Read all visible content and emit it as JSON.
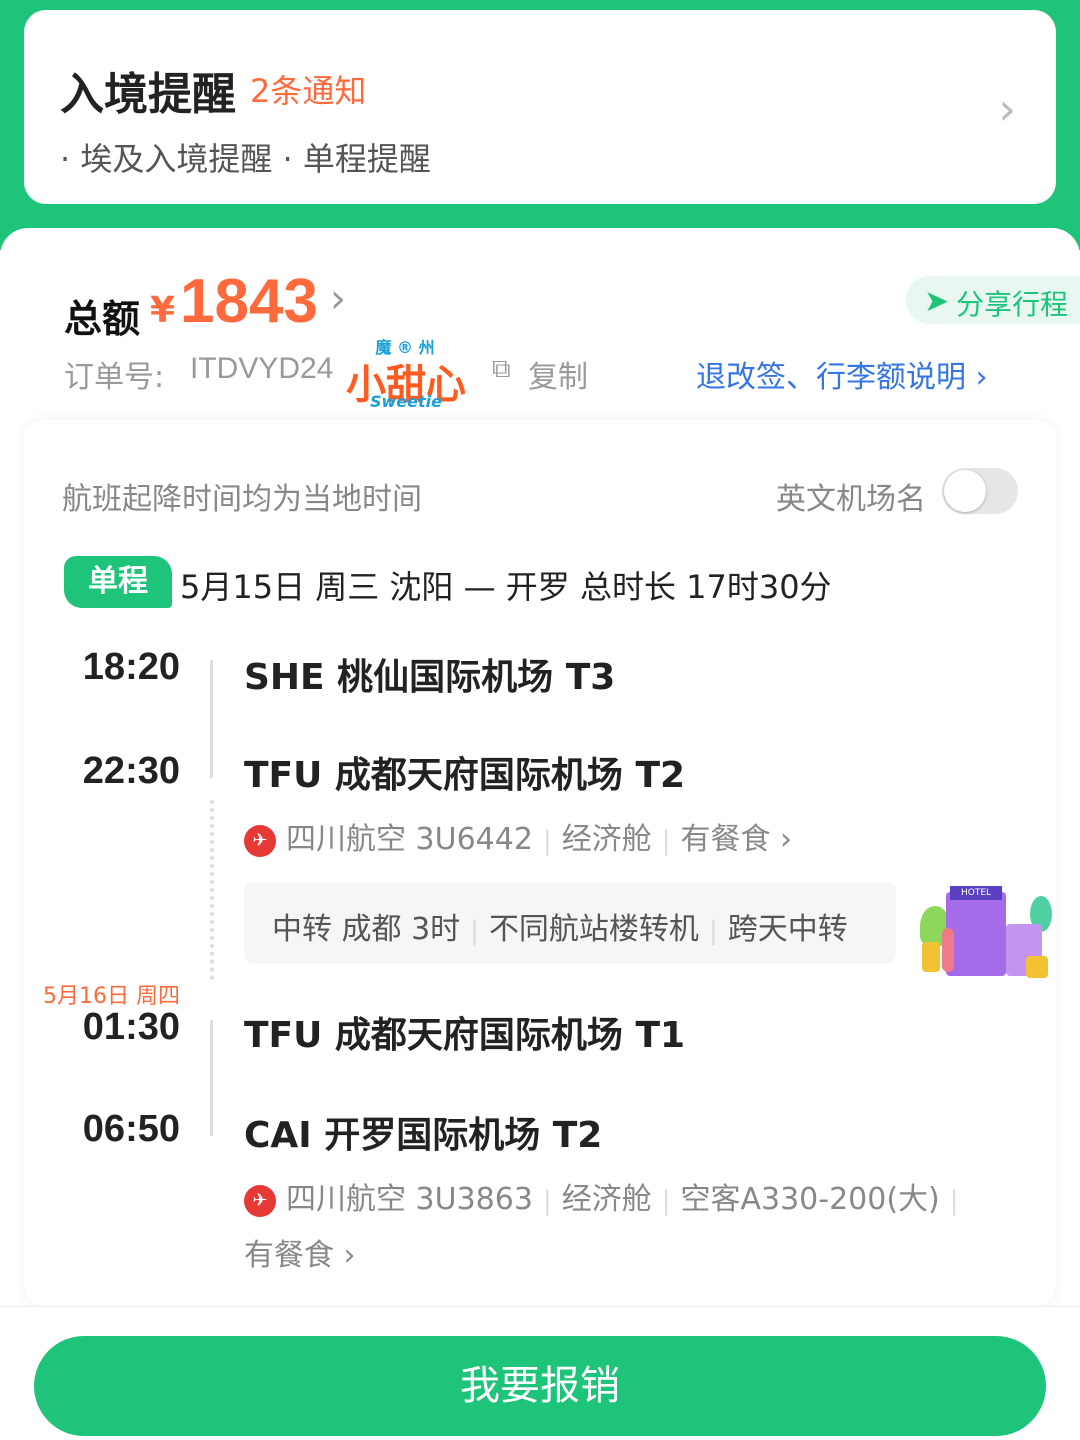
{
  "entry_notice": {
    "title": "入境提醒",
    "count": "2条通知",
    "items_text": "· 埃及入境提醒 · 单程提醒",
    "chevron": "›"
  },
  "order": {
    "total_label": "总额",
    "currency": "¥",
    "amount": "1843",
    "amount_chevron": "›",
    "share_label": "分享行程",
    "order_no_label": "订单号:",
    "order_no": "ITDVYD24",
    "copy_label": "复制",
    "policy_link": "退改签、行李额说明 ›"
  },
  "watermark": {
    "top": "魔 ® 州",
    "main": "小甜心",
    "sub": "Sweetie"
  },
  "flight": {
    "local_time_note": "航班起降时间均为当地时间",
    "english_airport_label": "英文机场名",
    "english_airport_on": false,
    "trip_type": "单程",
    "summary": "5月15日 周三 沈阳 — 开罗 总时长 17时30分",
    "segments": [
      {
        "dep_time": "18:20",
        "dep_airport": "SHE 桃仙国际机场 T3",
        "arr_time": "22:30",
        "arr_airport": "TFU 成都天府国际机场 T2",
        "airline": "四川航空 3U6442",
        "cabin": "经济舱",
        "meal": "有餐食 ›"
      },
      {
        "date_note": "5月16日 周四",
        "dep_time": "01:30",
        "dep_airport": "TFU 成都天府国际机场 T1",
        "arr_time": "06:50",
        "arr_airport": "CAI 开罗国际机场 T2",
        "airline": "四川航空 3U3863",
        "cabin": "经济舱",
        "aircraft": "空客A330-200(大)",
        "meal": "有餐食 ›"
      }
    ],
    "transfer": {
      "city": "中转 成都 3时",
      "terminal": "不同航站楼转机",
      "overnight": "跨天中转"
    },
    "hotel_sign": "HOTEL"
  },
  "bottom": {
    "claim_button": "我要报销"
  },
  "colors": {
    "brand_green": "#1ec47a",
    "price_orange": "#ff6a3d",
    "link_blue": "#3576e6"
  }
}
